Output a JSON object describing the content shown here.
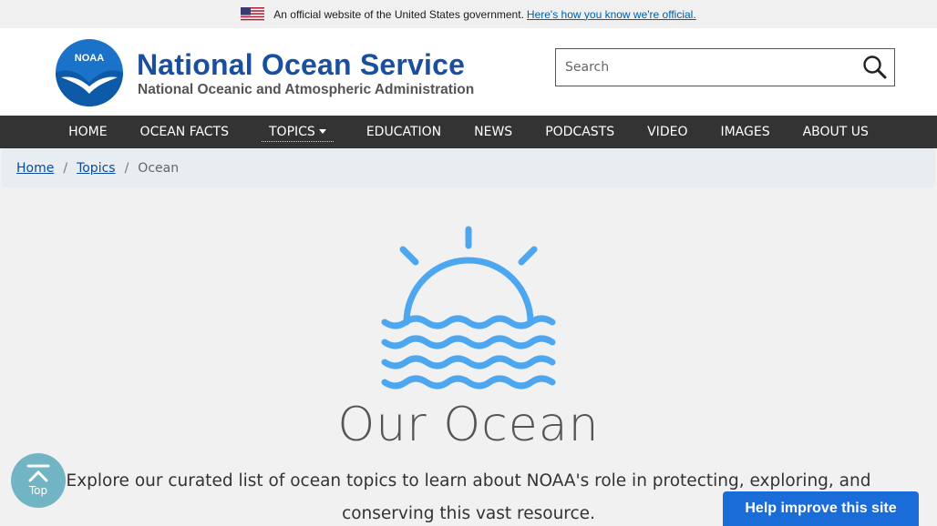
{
  "gov_banner": {
    "text": "An official website of the United States government.",
    "link": "Here's how you know we're official."
  },
  "header": {
    "logo_text": "NOAA",
    "title": "National Ocean Service",
    "subtitle": "National Oceanic and Atmospheric Administration"
  },
  "search": {
    "placeholder": "Search",
    "icon": "search-icon"
  },
  "nav": {
    "items": [
      {
        "label": "HOME"
      },
      {
        "label": "OCEAN FACTS"
      },
      {
        "label": "TOPICS"
      },
      {
        "label": "EDUCATION"
      },
      {
        "label": "NEWS"
      },
      {
        "label": "PODCASTS"
      },
      {
        "label": "VIDEO"
      },
      {
        "label": "IMAGES"
      },
      {
        "label": "ABOUT US"
      }
    ]
  },
  "breadcrumb": {
    "home": "Home",
    "topics": "Topics",
    "current": "Ocean"
  },
  "hero": {
    "icon": "sun-over-waves-icon",
    "title": "Our Ocean",
    "description": "Explore our curated list of ocean topics to learn about NOAA's role in protecting, exploring, and conserving this vast resource."
  },
  "top_button": {
    "label": "Top"
  },
  "feedback": {
    "label": "Help improve this site"
  },
  "colors": {
    "brand_blue": "#1a4fa0",
    "nav_bg": "#333333",
    "icon_blue": "#4da6f0",
    "feedback_bg": "#1a6cd8"
  }
}
